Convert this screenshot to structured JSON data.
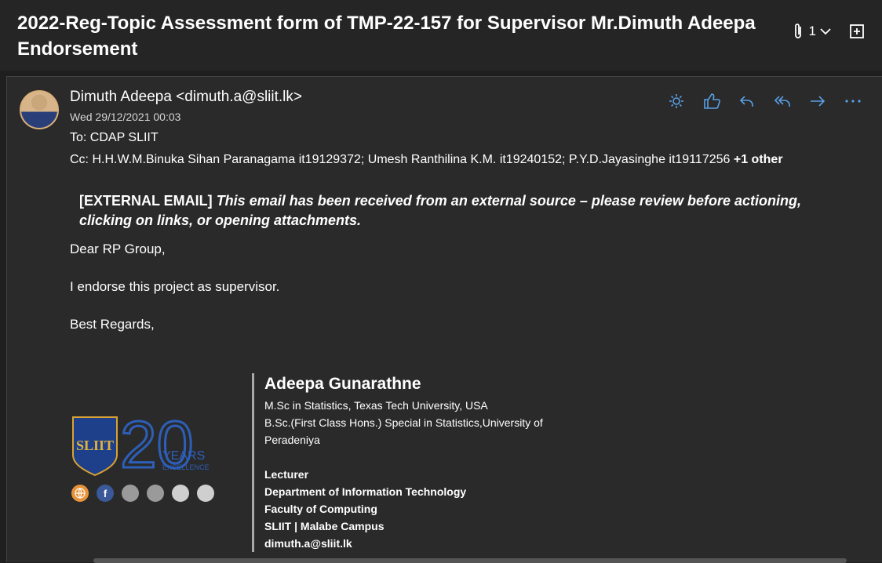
{
  "subject": "2022-Reg-Topic Assessment form of TMP-22-157 for Supervisor Mr.Dimuth Adeepa Endorsement",
  "attachments": {
    "count": "1"
  },
  "message": {
    "sender": "Dimuth Adeepa <dimuth.a@sliit.lk>",
    "date": "Wed 29/12/2021 00:03",
    "to_label": "To:",
    "to": "CDAP SLIIT",
    "cc_label": "Cc:",
    "cc": "H.H.W.M.Binuka Sihan Paranagama it19129372; Umesh Ranthilina K.M. it19240152; P.Y.D.Jayasinghe it19117256",
    "cc_more": "+1 other",
    "external_tag": "[EXTERNAL EMAIL]",
    "external_msg": "This email has been received from an external source – please review before actioning, clicking on links, or opening attachments.",
    "greeting": "Dear RP Group,",
    "body": "I endorse this project as supervisor.",
    "closing": "Best Regards,"
  },
  "signature": {
    "name": "Adeepa Gunarathne",
    "qual_1": "M.Sc in Statistics, Texas Tech University, USA",
    "qual_2": "B.Sc.(First Class Hons.) Special in Statistics,University of Peradeniya",
    "title": "Lecturer",
    "department": "Department of Information Technology",
    "faculty": "Faculty of Computing",
    "campus": "SLIIT | Malabe Campus",
    "email": "dimuth.a@sliit.lk",
    "logo_text": "SLIIT",
    "logo_number": "20",
    "logo_years": "YEARS",
    "logo_excellence": "EXCELLENCE",
    "facebook_glyph": "f"
  },
  "icons": {
    "attachment": "paperclip-icon",
    "expand": "chevron-down-icon",
    "popout": "open-window-icon",
    "summary": "sun-icon",
    "like": "thumbs-up-icon",
    "reply": "reply-icon",
    "reply_all": "reply-all-icon",
    "forward": "forward-icon",
    "more": "more-icon"
  },
  "colors": {
    "accent": "#5aa0e6",
    "background": "#2a2a2a"
  }
}
